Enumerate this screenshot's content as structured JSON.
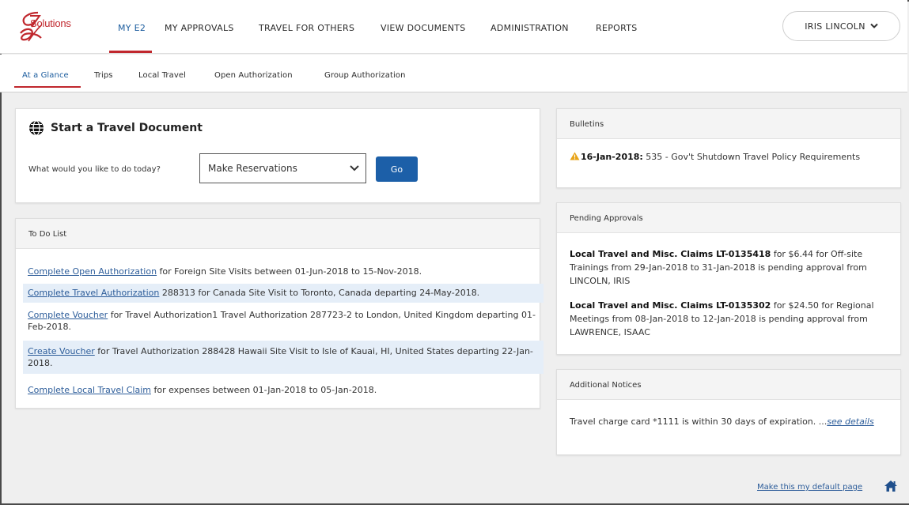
{
  "brand": {
    "logo_text": "Solutions",
    "accent": "#c0272d",
    "primary": "#1c5fa8",
    "link": "#2d5d9a"
  },
  "topnav": {
    "items": [
      {
        "label": "MY E2",
        "active": true
      },
      {
        "label": "MY APPROVALS"
      },
      {
        "label": "TRAVEL FOR OTHERS"
      },
      {
        "label": "VIEW DOCUMENTS"
      },
      {
        "label": "ADMINISTRATION"
      },
      {
        "label": "REPORTS"
      }
    ],
    "user": {
      "name": "IRIS LINCOLN",
      "icon": "chevron-down-icon"
    }
  },
  "subnav": {
    "items": [
      {
        "label": "At a Glance",
        "active": true
      },
      {
        "label": "Trips"
      },
      {
        "label": "Local Travel"
      },
      {
        "label": "Open Authorization"
      },
      {
        "label": "Group Authorization"
      }
    ]
  },
  "start_travel": {
    "title": "Start a Travel Document",
    "icon": "globe-icon",
    "prompt": "What would you like to do today?",
    "select_value": "Make Reservations",
    "go_label": "Go"
  },
  "todo": {
    "title": "To Do List",
    "items": [
      {
        "link": "Complete Open Authorization",
        "text": " for Foreign Site Visits between 01-Jun-2018 to 15-Nov-2018."
      },
      {
        "link": "Complete Travel Authorization",
        "text": " 288313 for Canada Site Visit to Toronto, Canada departing 24-May-2018."
      },
      {
        "link": "Complete Voucher",
        "text": " for Travel Authorization1 Travel Authorization 287723-2 to London, United Kingdom departing 01-Feb-2018."
      },
      {
        "link": "Create Voucher",
        "text": " for Travel Authorization 288428 Hawaii Site Visit to Isle of Kauai, HI, United States departing 22-Jan-2018."
      },
      {
        "link": "Complete Local Travel Claim",
        "text": " for expenses between 01-Jan-2018 to 05-Jan-2018."
      }
    ]
  },
  "bulletins": {
    "title": "Bulletins",
    "items": [
      {
        "icon": "warning-icon",
        "date": "16-Jan-2018:",
        "text": " 535 - Gov't Shutdown Travel Policy Requirements"
      }
    ]
  },
  "pending": {
    "title": "Pending Approvals",
    "items": [
      {
        "bold": "Local Travel and Misc. Claims LT-0135418",
        "text": " for $6.44 for Off-site Trainings from 29-Jan-2018 to 31-Jan-2018 is pending approval from LINCOLN, IRIS"
      },
      {
        "bold": "Local Travel and Misc. Claims LT-0135302",
        "text": " for $24.50 for Regional Meetings from 08-Jan-2018 to 12-Jan-2018 is pending approval from LAWRENCE, ISAAC"
      }
    ]
  },
  "notices": {
    "title": "Additional Notices",
    "text": "Travel charge card *1111 is within 30 days of expiration. ...",
    "link": "see details"
  },
  "footer": {
    "default_link": "Make this my default page",
    "icon": "home-icon"
  }
}
